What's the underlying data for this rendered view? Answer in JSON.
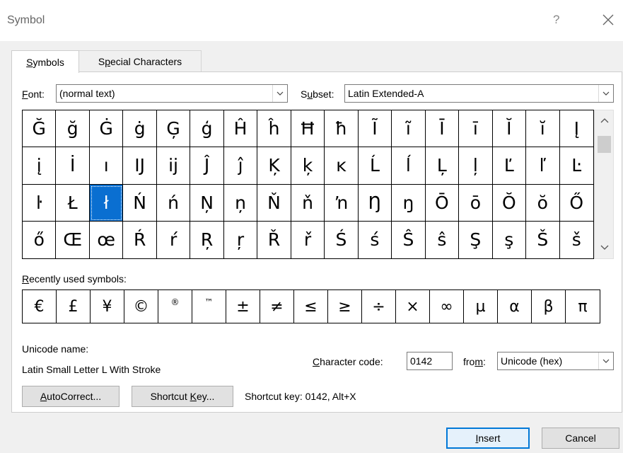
{
  "window": {
    "title": "Symbol",
    "help_label": "?"
  },
  "tabs": [
    {
      "label_underline": "S",
      "label_rest": "ymbols"
    },
    {
      "label_pre": "S",
      "label_underline": "p",
      "label_rest": "ecial Characters"
    }
  ],
  "font": {
    "label_underline": "F",
    "label_rest": "ont:",
    "value": "(normal text)"
  },
  "subset": {
    "label_pre": "S",
    "label_underline": "u",
    "label_rest": "bset:",
    "value": "Latin Extended-A"
  },
  "symbols": [
    [
      "Ğ",
      "ğ",
      "Ġ",
      "ġ",
      "Ģ",
      "ģ",
      "Ĥ",
      "ĥ",
      "Ħ",
      "ħ",
      "Ĩ",
      "ĩ",
      "Ī",
      "ī",
      "Ĭ",
      "ĭ",
      "Į"
    ],
    [
      "į",
      "İ",
      "ı",
      "Ĳ",
      "ĳ",
      "Ĵ",
      "ĵ",
      "Ķ",
      "ķ",
      "ĸ",
      "Ĺ",
      "ĺ",
      "Ļ",
      "ļ",
      "Ľ",
      "ľ",
      "Ŀ"
    ],
    [
      "ŀ",
      "Ł",
      "ł",
      "Ń",
      "ń",
      "Ņ",
      "ņ",
      "Ň",
      "ň",
      "ŉ",
      "Ŋ",
      "ŋ",
      "Ō",
      "ō",
      "Ŏ",
      "ŏ",
      "Ő"
    ],
    [
      "ő",
      "Œ",
      "œ",
      "Ŕ",
      "ŕ",
      "Ŗ",
      "ŗ",
      "Ř",
      "ř",
      "Ś",
      "ś",
      "Ŝ",
      "ŝ",
      "Ş",
      "ş",
      "Š",
      "š"
    ]
  ],
  "selected_symbol": {
    "row": 2,
    "col": 2
  },
  "recent": {
    "label_underline": "R",
    "label_rest": "ecently used symbols:",
    "items": [
      "€",
      "£",
      "¥",
      "©",
      "®",
      "™",
      "±",
      "≠",
      "≤",
      "≥",
      "÷",
      "×",
      "∞",
      "µ",
      "α",
      "β",
      "π"
    ]
  },
  "unicode_name": {
    "label": "Unicode name:",
    "value": "Latin Small Letter L With Stroke"
  },
  "char_code": {
    "label_underline": "C",
    "label_rest": "haracter code:",
    "value": "0142"
  },
  "from": {
    "label_pre": "fro",
    "label_underline": "m",
    "label_rest": ":",
    "value": "Unicode (hex)"
  },
  "buttons": {
    "autocorrect": {
      "label_underline": "A",
      "label_rest": "utoCorrect..."
    },
    "shortcut_key": {
      "label_pre": "Shortcut ",
      "label_underline": "K",
      "label_rest": "ey..."
    },
    "insert": {
      "label_underline": "I",
      "label_rest": "nsert"
    },
    "cancel": "Cancel"
  },
  "shortcut_text": "Shortcut key: 0142, Alt+X",
  "colors": {
    "accent": "#0078d7",
    "selection": "#0a6fd1",
    "background": "#f0f0f0"
  },
  "icons": [
    "help-icon",
    "close-icon",
    "chevron-down-icon",
    "chevron-up-icon"
  ]
}
